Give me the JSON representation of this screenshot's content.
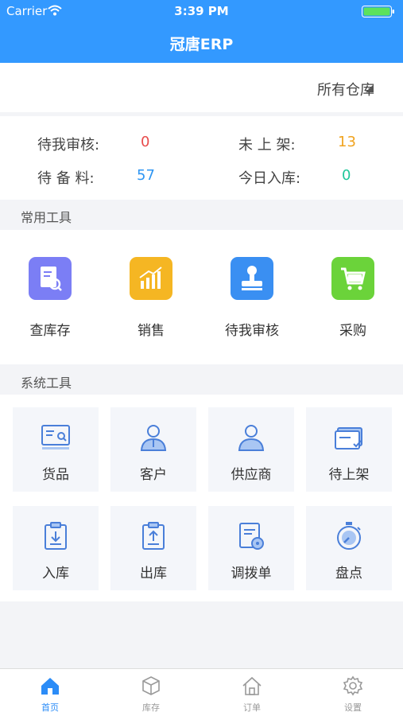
{
  "status_bar": {
    "carrier": "Carrier",
    "time": "3:39 PM"
  },
  "nav": {
    "title": "冠唐ERP"
  },
  "warehouse": {
    "selected": "所有仓库"
  },
  "stats": [
    {
      "label": "待我审核:",
      "value": "0",
      "color": "#e84c4c"
    },
    {
      "label": "未 上 架:",
      "value": "13",
      "color": "#f0a31f"
    },
    {
      "label": "待 备 料:",
      "value": "57",
      "color": "#2f96f3"
    },
    {
      "label": "今日入库:",
      "value": "0",
      "color": "#1fc79a"
    }
  ],
  "common_tools": {
    "title": "常用工具",
    "items": [
      {
        "label": "查库存",
        "icon": "inventory-search-icon",
        "color": "#7b7ef5"
      },
      {
        "label": "销售",
        "icon": "sales-chart-icon",
        "color": "#f5b623"
      },
      {
        "label": "待我审核",
        "icon": "stamp-icon",
        "color": "#3a8ff2"
      },
      {
        "label": "采购",
        "icon": "cart-icon",
        "color": "#6bd33a"
      }
    ]
  },
  "system_tools": {
    "title": "系统工具",
    "items": [
      {
        "label": "货品",
        "icon": "goods-icon"
      },
      {
        "label": "客户",
        "icon": "customer-icon"
      },
      {
        "label": "供应商",
        "icon": "supplier-icon"
      },
      {
        "label": "待上架",
        "icon": "pending-shelf-icon"
      },
      {
        "label": "入库",
        "icon": "inbound-icon"
      },
      {
        "label": "出库",
        "icon": "outbound-icon"
      },
      {
        "label": "调拨单",
        "icon": "transfer-order-icon"
      },
      {
        "label": "盘点",
        "icon": "stocktake-icon"
      }
    ]
  },
  "tabbar": {
    "items": [
      {
        "label": "首页",
        "icon": "home-icon",
        "active": true
      },
      {
        "label": "库存",
        "icon": "box-icon",
        "active": false
      },
      {
        "label": "订单",
        "icon": "order-icon",
        "active": false
      },
      {
        "label": "设置",
        "icon": "gear-icon",
        "active": false
      }
    ]
  }
}
